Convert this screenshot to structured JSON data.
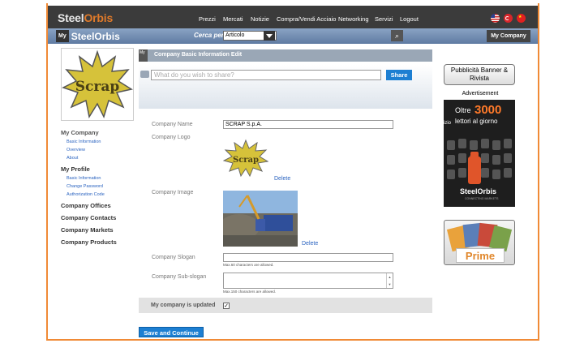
{
  "header": {
    "logo_text": "Steel",
    "logo_text_accent": "Orbis",
    "nav": [
      "Prezzi",
      "Mercati",
      "Notizie",
      "Compra/Vendi Acciaio",
      "Networking",
      "Servizi",
      "Logout"
    ],
    "flags": [
      "us-flag-icon",
      "tr-flag-icon",
      "cn-flag-icon"
    ]
  },
  "subheader": {
    "my_label": "My",
    "brand": "SteelOrbis",
    "search_label": "Cerca per",
    "search_value": "Articolo",
    "my_company": "My Company"
  },
  "sidebar": {
    "avatar_text": "Scrap",
    "my_company": "My Company",
    "my_company_items": [
      "Basic Information",
      "Overview",
      "About"
    ],
    "my_profile": "My Profile",
    "my_profile_items": [
      "Basic Information",
      "Change Password",
      "Authorization Code"
    ],
    "links": [
      "Company Offices",
      "Company Contacts",
      "Company Markets",
      "Company Products"
    ]
  },
  "main": {
    "title_icon_text": "My",
    "title": "Company Basic Information Edit",
    "share_placeholder": "What do you wish to share?",
    "share_button": "Share",
    "company_name_label": "Company Name",
    "company_name_value": "SCRAP S.p.A.",
    "company_logo_label": "Company Logo",
    "logo_text": "Scrap",
    "delete_label": "Delete",
    "company_image_label": "Company Image",
    "slogan_label": "Company Slogan",
    "slogan_hint": "Max.60 characters are allowed.",
    "subslogan_label": "Company Sub-slogan",
    "subslogan_hint": "Max.150 characters are allowed.",
    "updated_label": "My company is updated",
    "updated_checked": true,
    "save_button": "Save and Continue"
  },
  "rightbar": {
    "banner_button": "Pubblicità Banner & Rivista",
    "advertisement_label": "Advertisement",
    "ad_line1": "Oltre",
    "ad_number": "3000",
    "ad_line2": "lettori al giorno",
    "ad_side_text": "izio",
    "ad_brand": "SteelOrbis",
    "ad_tagline": "CONNECTING MARKETS",
    "prime_label": "Prime"
  },
  "colors": {
    "frame_border": "#f08a36",
    "topbar": "#3b3b3b",
    "accent_blue": "#1d7fd2",
    "link_blue": "#2a63c0",
    "logo_yellow": "#d6c23a"
  }
}
